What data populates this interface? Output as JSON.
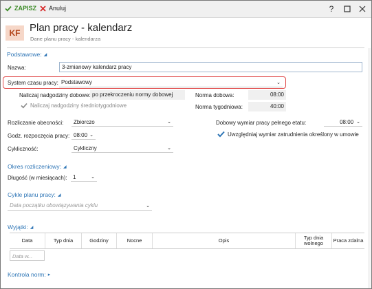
{
  "toolbar": {
    "save_label": "ZAPISZ",
    "cancel_label": "Anuluj",
    "help_label": "?"
  },
  "header": {
    "avatar": "KF",
    "title": "Plan pracy - kalendarz",
    "subtitle": "Dane planu pracy - kalendarza"
  },
  "basic": {
    "section_title": "Podstawowe:",
    "name_label": "Nazwa:",
    "name_value": "3-zmianowy kalendarz pracy",
    "work_time_system_label": "System czasu pracy:",
    "work_time_system_value": "Podstawowy",
    "overtime_daily_label": "Naliczaj nadgodziny dobowe:",
    "overtime_daily_value": "po przekroczeniu normy dobowej",
    "overtime_avg_label": "Naliczaj nadgodziny średniotygodniowe",
    "daily_norm_label": "Norma dobowa:",
    "daily_norm_value": "08:00",
    "weekly_norm_label": "Norma tygodniowa:",
    "weekly_norm_value": "40:00",
    "attendance_label": "Rozliczanie obecności:",
    "attendance_value": "Zbiorczo",
    "start_hour_label": "Godz. rozpoczęcia pracy:",
    "start_hour_value": "08:00",
    "cyclicity_label": "Cykliczność:",
    "cyclicity_value": "Cykliczny",
    "daily_fulltime_label": "Dobowy wymiar pracy pełnego etatu:",
    "daily_fulltime_value": "08:00",
    "include_contract_label": "Uwzględniaj wymiar zatrudnienia określony w umowie"
  },
  "settlement": {
    "section_title": "Okres rozliczeniowy:",
    "length_label": "Długość (w miesiącach):",
    "length_value": "1"
  },
  "cycles": {
    "section_title": "Cykle planu pracy:",
    "start_date_placeholder": "Data początku obowiązywania cyklu"
  },
  "exceptions": {
    "section_title": "Wyjątki:",
    "columns": [
      "Data",
      "Typ dnia",
      "Godziny",
      "Nocne",
      "Opis",
      "Typ dnia wolnego",
      "Praca zdalna"
    ],
    "date_placeholder": "Data w..."
  },
  "norm_control": {
    "section_title": "Kontrola norm:"
  },
  "colors": {
    "accent": "#2f76b6",
    "save_green": "#3b8a26",
    "cancel_red": "#d62b2b",
    "highlight_red": "#e04848",
    "avatar_bg": "#f6d7c8",
    "avatar_text": "#b3451a"
  }
}
